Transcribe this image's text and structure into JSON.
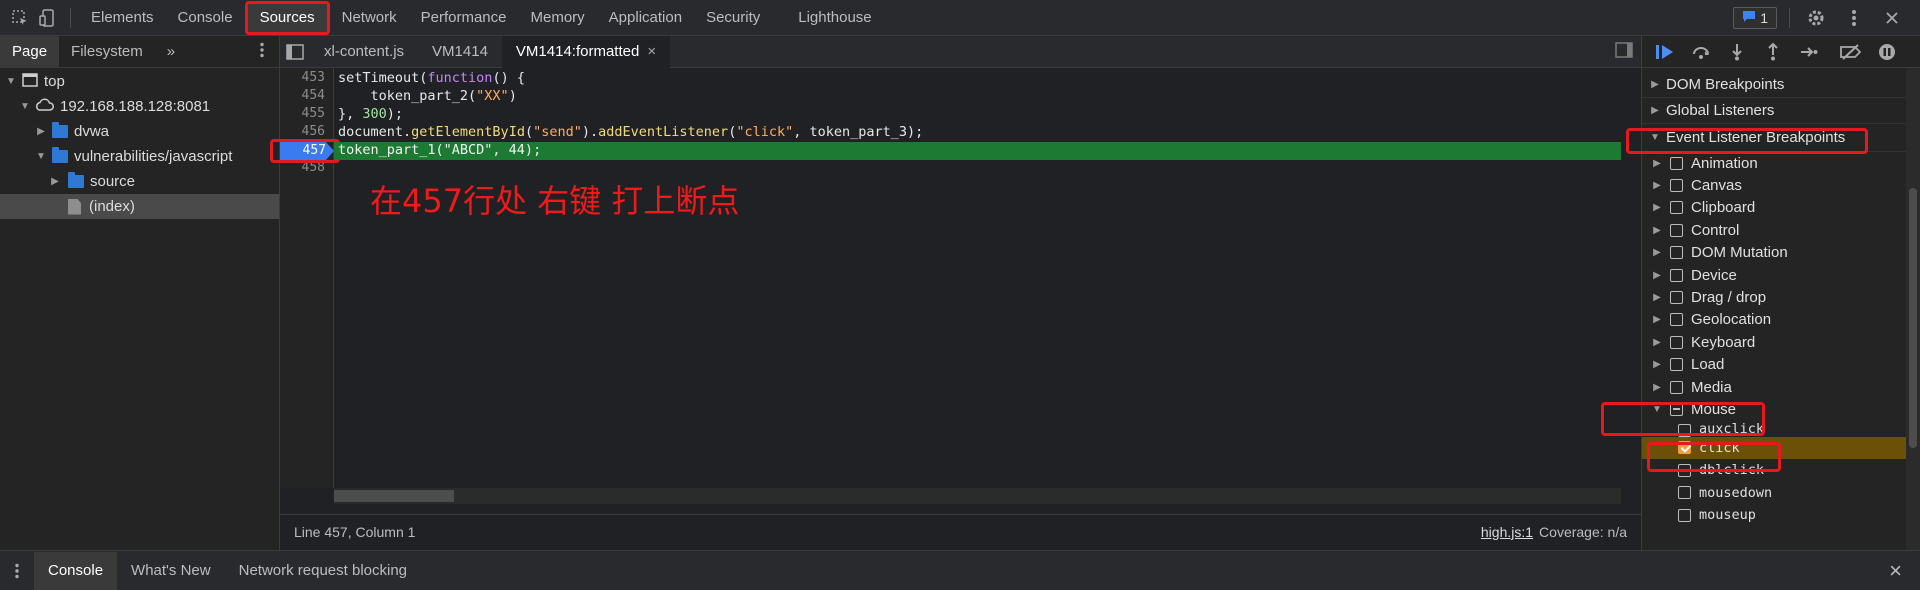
{
  "toolbar": {
    "inspect_icon": "inspect-element-icon",
    "device_icon": "device-toolbar-icon",
    "tabs": [
      "Elements",
      "Console",
      "Sources",
      "Network",
      "Performance",
      "Memory",
      "Application",
      "Security",
      "Lighthouse"
    ],
    "active_tab": "Sources",
    "issues_count": "1"
  },
  "navigator": {
    "tabs": [
      "Page",
      "Filesystem"
    ],
    "more": "»",
    "tree": [
      {
        "label": "top",
        "level": 0,
        "type": "frame"
      },
      {
        "label": "192.168.188.128:8081",
        "level": 1,
        "type": "cloud"
      },
      {
        "label": "dvwa",
        "level": 2,
        "type": "folder"
      },
      {
        "label": "vulnerabilities/javascript",
        "level": 2,
        "type": "folder"
      },
      {
        "label": "source",
        "level": 3,
        "type": "folder"
      },
      {
        "label": "(index)",
        "level": 3,
        "type": "file"
      }
    ]
  },
  "editor": {
    "tabs": [
      "xl-content.js",
      "VM1414",
      "VM1414:formatted"
    ],
    "active_tab": "VM1414:formatted",
    "close_glyph": "×",
    "line_numbers": [
      "453",
      "454",
      "455",
      "456",
      "457",
      "458"
    ],
    "breakpoint_line": "457",
    "code": {
      "l453_a": "setTimeout(",
      "l453_kw": "function",
      "l453_b": "() {",
      "l454_a": "    token_part_2(",
      "l454_str": "\"XX\"",
      "l454_b": ")",
      "l455_a": "}, ",
      "l455_num": "300",
      "l455_b": ");",
      "l456_a": "document.",
      "l456_fn": "getElementById",
      "l456_b": "(",
      "l456_str1": "\"send\"",
      "l456_c": ").",
      "l456_fn2": "addEventListener",
      "l456_d": "(",
      "l456_str2": "\"click\"",
      "l456_e": ", token_part_3);",
      "l457": "token_part_1(\"ABCD\", 44);"
    },
    "annotation": "在457行处 右键 打上断点",
    "status_left": "Line 457, Column 1",
    "status_link": "high.js:1",
    "status_coverage": "Coverage: n/a"
  },
  "debugger": {
    "sections": [
      "DOM Breakpoints",
      "Global Listeners",
      "Event Listener Breakpoints"
    ],
    "categories": [
      "Animation",
      "Canvas",
      "Clipboard",
      "Control",
      "DOM Mutation",
      "Device",
      "Drag / drop",
      "Geolocation",
      "Keyboard",
      "Load",
      "Media",
      "Mouse"
    ],
    "mouse_events": [
      "auxclick",
      "click",
      "dblclick",
      "mousedown",
      "mouseup"
    ],
    "checked_event": "click"
  },
  "drawer": {
    "tabs": [
      "Console",
      "What's New",
      "Network request blocking"
    ],
    "active_tab": "Console",
    "close_glyph": "×"
  },
  "colors": {
    "annotation_red": "#e5191e",
    "execution_line": "#1c7a33",
    "breakpoint_blue": "#3b7bf0",
    "checkbox_orange": "#f59d3a"
  }
}
